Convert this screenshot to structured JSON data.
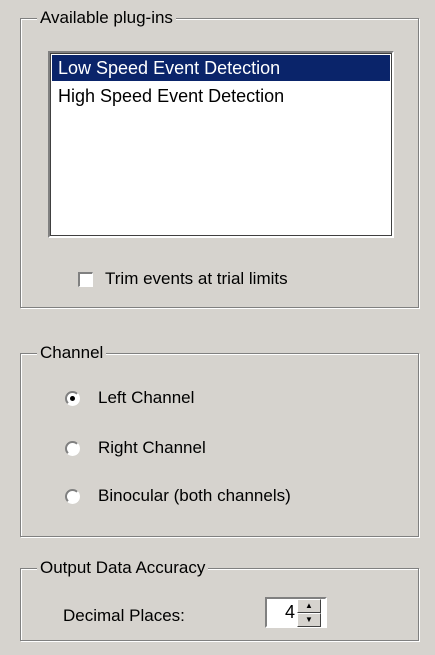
{
  "plugins": {
    "group_label": "Available plug-ins",
    "items": [
      "Low Speed Event Detection",
      "High Speed Event Detection"
    ],
    "selected_index": 0,
    "trim_label": "Trim events at trial limits",
    "trim_checked": false
  },
  "channel": {
    "group_label": "Channel",
    "options": [
      "Left Channel",
      "Right Channel",
      "Binocular (both channels)"
    ],
    "selected_index": 0
  },
  "accuracy": {
    "group_label": "Output Data Accuracy",
    "decimal_label": "Decimal Places:",
    "decimal_value": "4"
  },
  "colors": {
    "face": "#d6d3ce",
    "selection": "#0a246a"
  }
}
